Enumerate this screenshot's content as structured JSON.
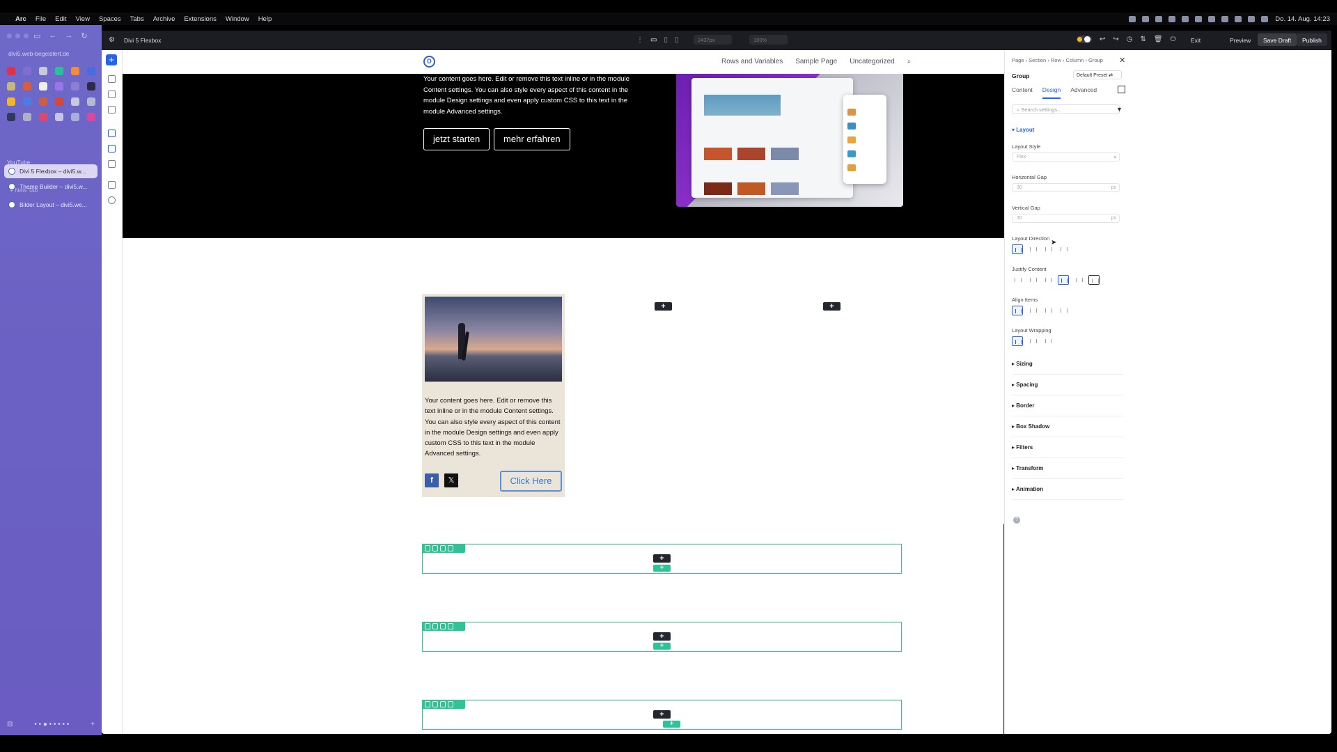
{
  "menubar": {
    "items": [
      "Arc",
      "File",
      "Edit",
      "View",
      "Spaces",
      "Tabs",
      "Archive",
      "Extensions",
      "Window",
      "Help"
    ],
    "datetime": "Do. 14. Aug. 14:23"
  },
  "arc": {
    "url": "divi5.web-begeistert.de",
    "section": "YouTube",
    "new_tab": "+ New Tab",
    "tabs": [
      {
        "label": "Divi 5 Flexbox – divi5.w..."
      },
      {
        "label": "Theme Builder – divi5.w..."
      },
      {
        "label": "Bilder Layout – divi5.we..."
      }
    ]
  },
  "topbar": {
    "title": "Divi 5 Flexbox",
    "width_value": "2437px",
    "zoom_value": "100%",
    "exit": "Exit",
    "preview": "Preview",
    "save": "Save Draft",
    "publish": "Publish"
  },
  "site": {
    "logo": "D",
    "menu": [
      "Rows and Variables",
      "Sample Page",
      "Uncategorized"
    ],
    "hero_text": "Your content goes here. Edit or remove this text inline or in the module Content settings. You can also style every aspect of this content in the module Design settings and even apply custom CSS to this text in the module Advanced settings.",
    "btn_start": "jetzt starten",
    "btn_more": "mehr erfahren",
    "card_text": "Your content goes here. Edit or remove this text inline or in the module Content settings. You can also style every aspect of this content in the module Design settings and even apply custom CSS to this text in the module Advanced settings.",
    "card_button": "Click Here",
    "fb": "f",
    "x": "𝕏"
  },
  "panel": {
    "breadcrumb": "Page › Section › Row › Column › Group",
    "heading": "Group",
    "preset": "Default Preset ⇄",
    "tabs": [
      "Content",
      "Design",
      "Advanced"
    ],
    "search_placeholder": "Search settings...",
    "section": "Layout",
    "labels": {
      "layout_style": "Layout Style",
      "horizontal_gap": "Horizontal Gap",
      "vertical_gap": "Vertical Gap",
      "layout_direction": "Layout Direction",
      "justify_content": "Justify Content",
      "align_items": "Align Items",
      "layout_wrapping": "Layout Wrapping"
    },
    "layout_style_value": "Flex",
    "hgap_value": "30",
    "vgap_value": "30",
    "unit": "px",
    "collapsed": [
      "Sizing",
      "Spacing",
      "Border",
      "Box Shadow",
      "Filters",
      "Transform",
      "Animation"
    ]
  },
  "colors": {
    "accent": "#2563eb",
    "row_outline": "#2ec495",
    "arc_sidebar": "#6b61c4"
  }
}
